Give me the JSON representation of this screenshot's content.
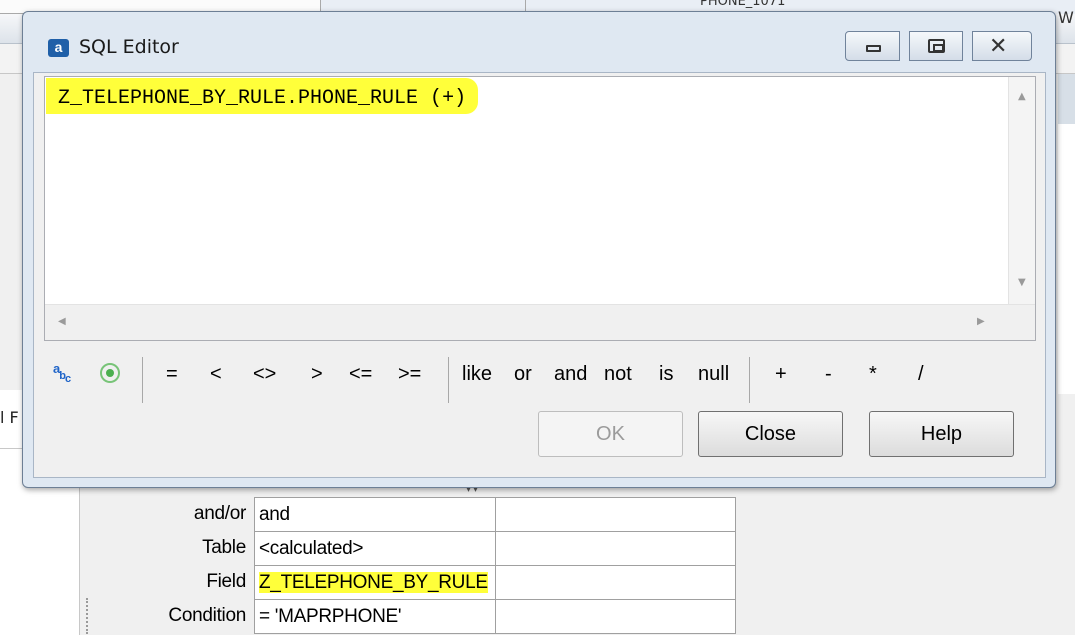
{
  "background": {
    "top_text_left": "",
    "top_text_right": "PHONE_1071",
    "right_edge_text": "W",
    "left_fragment": "l F"
  },
  "dialog": {
    "title": "SQL Editor",
    "app_icon_letter": "a",
    "editor_text": "Z_TELEPHONE_BY_RULE.PHONE_RULE (+)",
    "toolbar": {
      "ops1": [
        "=",
        "<",
        "<>",
        ">",
        "<=",
        ">="
      ],
      "ops2": [
        "like",
        "or",
        "and",
        "not",
        "is",
        "null"
      ],
      "ops3": [
        "+",
        "-",
        "*",
        "/"
      ]
    },
    "buttons": {
      "ok": "OK",
      "close": "Close",
      "help": "Help"
    }
  },
  "condition_grid": {
    "labels": [
      "and/or",
      "Table",
      "Field",
      "Condition"
    ],
    "values": [
      "and",
      "<calculated>",
      "Z_TELEPHONE_BY_RULE",
      "= 'MAPRPHONE'"
    ]
  },
  "colors": {
    "highlight": "#ffff3a",
    "accent": "#1f5fa8"
  }
}
